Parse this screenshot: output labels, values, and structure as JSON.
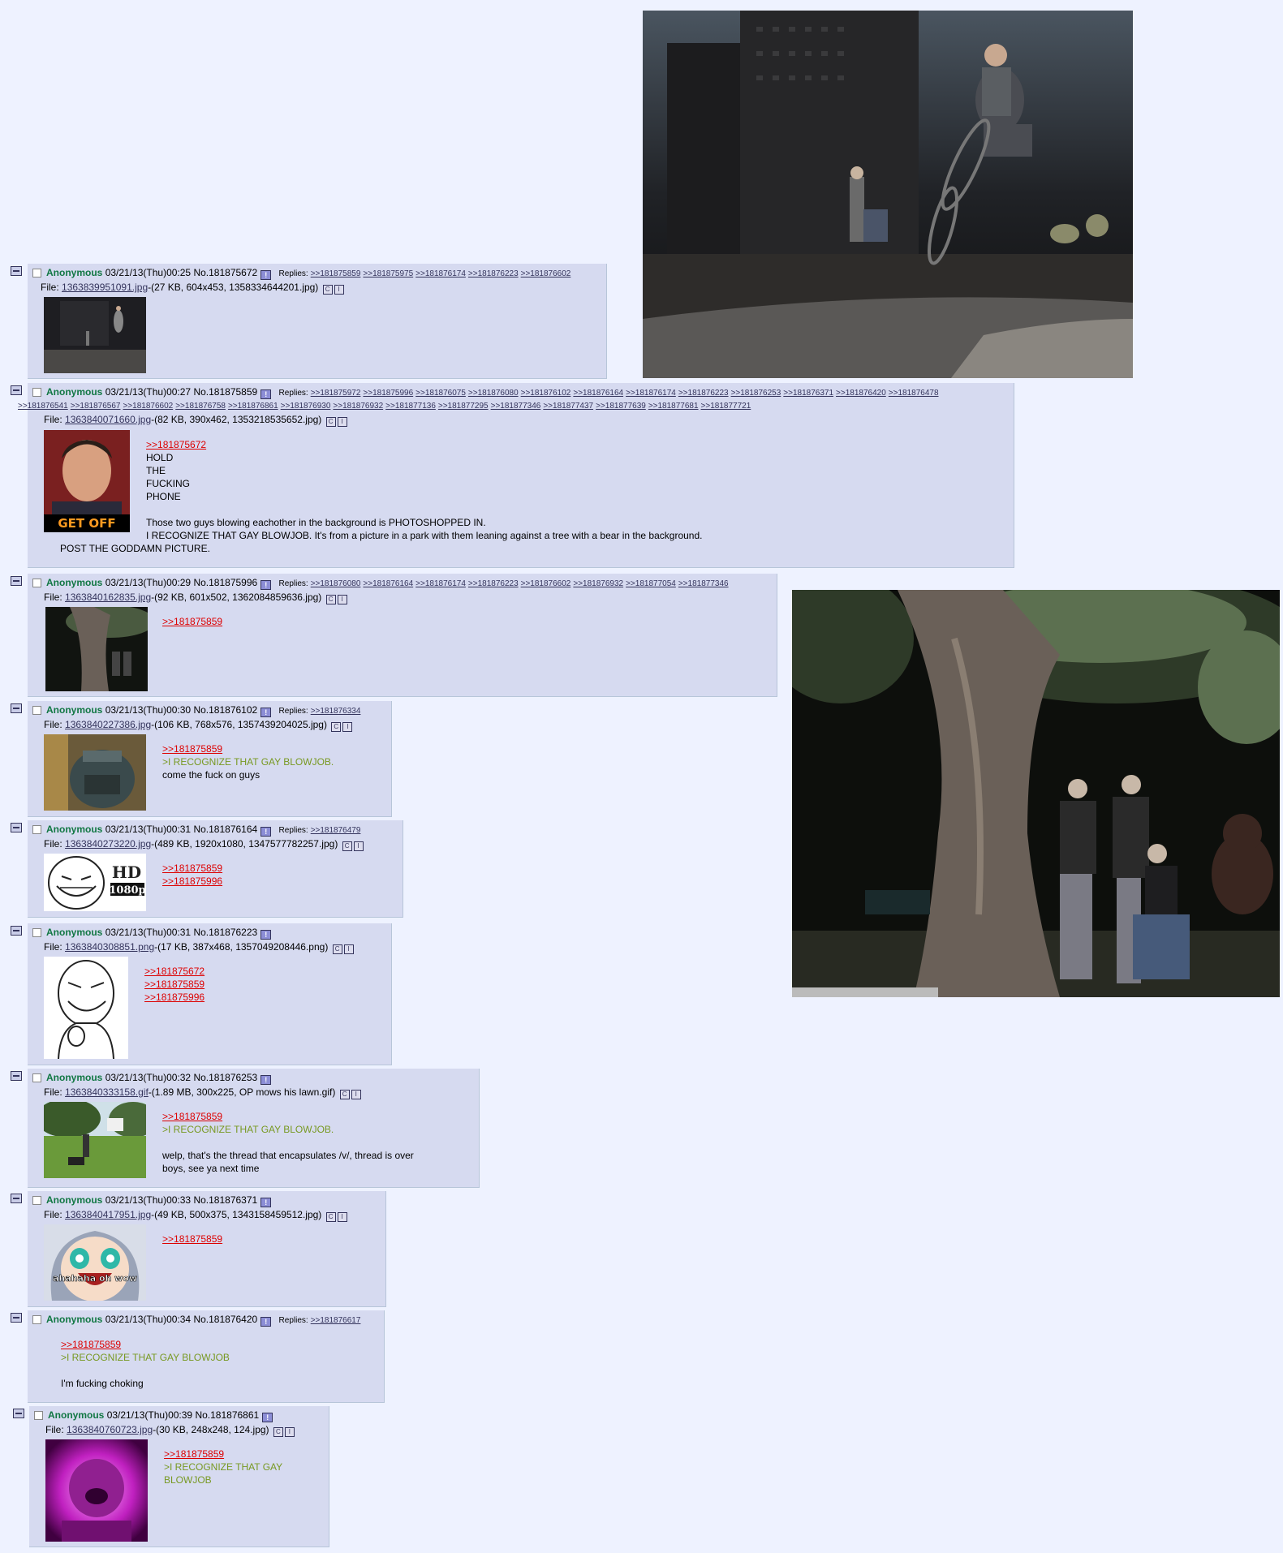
{
  "posts": [
    {
      "name": "Anonymous",
      "datetime": "03/21/13(Thu)00:25",
      "no": "No.181875672",
      "replies_label": "Replies:",
      "replies": [
        ">>181875859",
        ">>181875975",
        ">>181876174",
        ">>181876223",
        ">>181876602"
      ],
      "file_label": "File:",
      "file_name": "1363839951091.jpg",
      "file_meta": "-(27 KB, 604x453, 1358334644201.jpg)",
      "body": []
    },
    {
      "name": "Anonymous",
      "datetime": "03/21/13(Thu)00:27",
      "no": "No.181875859",
      "replies_label": "Replies:",
      "replies": [
        ">>181875972",
        ">>181875996",
        ">>181876075",
        ">>181876080",
        ">>181876102",
        ">>181876164",
        ">>181876174",
        ">>181876223",
        ">>181876253",
        ">>181876371",
        ">>181876420",
        ">>181876478"
      ],
      "replies2": [
        ">>181876541",
        ">>181876567",
        ">>181876602",
        ">>181876758",
        ">>181876861",
        ">>181876930",
        ">>181876932",
        ">>181877136",
        ">>181877295",
        ">>181877346",
        ">>181877437",
        ">>181877639",
        ">>181877681",
        ">>181877721"
      ],
      "file_label": "File:",
      "file_name": "1363840071660.jpg",
      "file_meta": "-(82 KB, 390x462, 1353218535652.jpg)",
      "thumb_caption": "GET OFF",
      "quote": ">>181875672",
      "body": [
        "HOLD",
        "THE",
        "FUCKING",
        "PHONE",
        "",
        "Those two guys blowing eachother in the background is PHOTOSHOPPED IN.",
        "I RECOGNIZE THAT GAY BLOWJOB. It's from a picture in a park with them leaning against a tree with a bear in the background."
      ],
      "tail": "POST THE GODDAMN PICTURE."
    },
    {
      "name": "Anonymous",
      "datetime": "03/21/13(Thu)00:29",
      "no": "No.181875996",
      "replies_label": "Replies:",
      "replies": [
        ">>181876080",
        ">>181876164",
        ">>181876174",
        ">>181876223",
        ">>181876602",
        ">>181876932",
        ">>181877054",
        ">>181877346"
      ],
      "file_label": "File:",
      "file_name": "1363840162835.jpg",
      "file_meta": "-(92 KB, 601x502, 1362084859636.jpg)",
      "quote": ">>181875859",
      "body": []
    },
    {
      "name": "Anonymous",
      "datetime": "03/21/13(Thu)00:30",
      "no": "No.181876102",
      "replies_label": "Replies:",
      "replies": [
        ">>181876334"
      ],
      "file_label": "File:",
      "file_name": "1363840227386.jpg",
      "file_meta": "-(106 KB, 768x576, 1357439204025.jpg)",
      "quote": ">>181875859",
      "green": ">I RECOGNIZE THAT GAY BLOWJOB.",
      "body": [
        "come the fuck on guys"
      ]
    },
    {
      "name": "Anonymous",
      "datetime": "03/21/13(Thu)00:31",
      "no": "No.181876164",
      "replies_label": "Replies:",
      "replies": [
        ">>181876479"
      ],
      "file_label": "File:",
      "file_name": "1363840273220.jpg",
      "file_meta": "-(489 KB, 1920x1080, 1347577782257.jpg)",
      "thumb_caption": "HD",
      "thumb_caption2": "1080p",
      "quotes": [
        ">>181875859",
        ">>181875996"
      ],
      "body": []
    },
    {
      "name": "Anonymous",
      "datetime": "03/21/13(Thu)00:31",
      "no": "No.181876223",
      "replies": [],
      "file_label": "File:",
      "file_name": "1363840308851.png",
      "file_meta": "-(17 KB, 387x468, 1357049208446.png)",
      "quotes": [
        ">>181875672",
        ">>181875859",
        ">>181875996"
      ],
      "body": []
    },
    {
      "name": "Anonymous",
      "datetime": "03/21/13(Thu)00:32",
      "no": "No.181876253",
      "replies": [],
      "file_label": "File:",
      "file_name": "1363840333158.gif",
      "file_meta": "-(1.89 MB, 300x225, OP mows his lawn.gif)",
      "quote": ">>181875859",
      "green": ">I RECOGNIZE THAT GAY BLOWJOB.",
      "body": [
        "welp, that's the thread that encapsulates /v/, thread is over",
        "boys, see ya next time"
      ]
    },
    {
      "name": "Anonymous",
      "datetime": "03/21/13(Thu)00:33",
      "no": "No.181876371",
      "replies": [],
      "file_label": "File:",
      "file_name": "1363840417951.jpg",
      "file_meta": "-(49 KB, 500x375, 1343158459512.jpg)",
      "thumb_caption": "ahahaha oh wow",
      "quote": ">>181875859",
      "body": []
    },
    {
      "name": "Anonymous",
      "datetime": "03/21/13(Thu)00:34",
      "no": "No.181876420",
      "replies_label": "Replies:",
      "replies": [
        ">>181876617"
      ],
      "quote": ">>181875859",
      "green": ">I RECOGNIZE THAT GAY BLOWJOB",
      "body": [
        "I'm fucking choking"
      ]
    },
    {
      "name": "Anonymous",
      "datetime": "03/21/13(Thu)00:39",
      "no": "No.181876861",
      "replies": [],
      "file_label": "File:",
      "file_name": "1363840760723.jpg",
      "file_meta": "-(30 KB, 248x248, 124.jpg)",
      "quote": ">>181875859",
      "green": ">I RECOGNIZE THAT GAY",
      "green2": "BLOWJOB",
      "body": []
    }
  ],
  "buttons": {
    "flag": "!",
    "c": "C",
    "i": "I"
  }
}
